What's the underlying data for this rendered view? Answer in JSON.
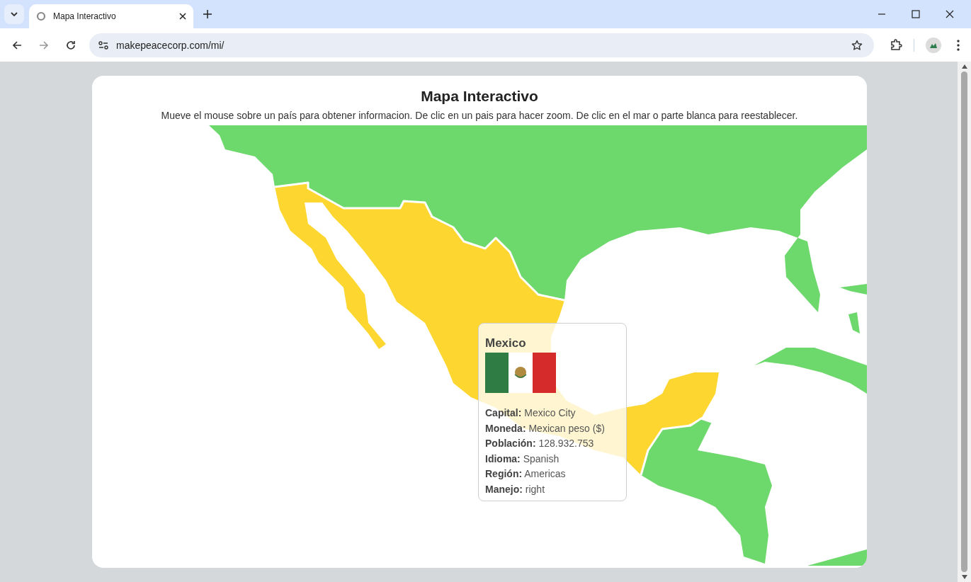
{
  "browser": {
    "tab": {
      "title": "Mapa Interactivo"
    },
    "address": "makepeacecorp.com/mi/"
  },
  "page": {
    "title": "Mapa Interactivo",
    "subtitle": "Mueve el mouse sobre un país para obtener informacion. De clic en un pais para hacer zoom. De clic en el mar o parte blanca para reestablecer."
  },
  "tooltip": {
    "country": "Mexico",
    "fields": [
      {
        "label": "Capital:",
        "value": "Mexico City"
      },
      {
        "label": "Moneda:",
        "value": "Mexican peso ($)"
      },
      {
        "label": "Población:",
        "value": "128.932.753"
      },
      {
        "label": "Idioma:",
        "value": "Spanish"
      },
      {
        "label": "Región:",
        "value": "Americas"
      },
      {
        "label": "Manejo:",
        "value": "right"
      }
    ]
  }
}
